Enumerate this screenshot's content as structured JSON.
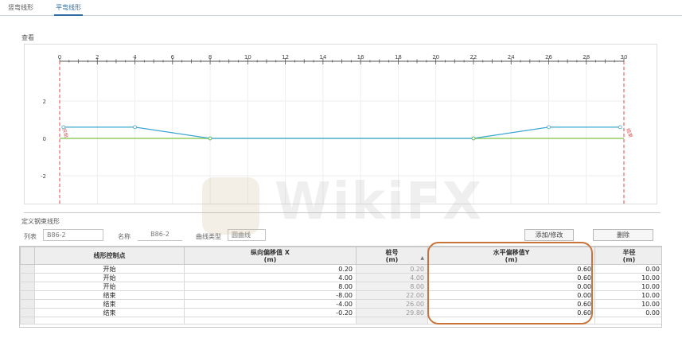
{
  "tabs": [
    {
      "label": "竖弯线形",
      "active": false
    },
    {
      "label": "平弯线形",
      "active": true
    }
  ],
  "view_label": "查看",
  "chart_data": {
    "type": "line",
    "x_ticks": [
      0,
      2,
      4,
      6,
      8,
      10,
      12,
      14,
      16,
      18,
      20,
      22,
      24,
      26,
      28,
      30
    ],
    "y_ticks": [
      2,
      0,
      -2
    ],
    "xlim": [
      0,
      30
    ],
    "ylim": [
      -3.2,
      4.2
    ],
    "series": [
      {
        "color": "#3ba5d4",
        "points": [
          [
            0.2,
            0.6
          ],
          [
            4,
            0.6
          ],
          [
            8,
            0
          ],
          [
            22,
            0
          ],
          [
            26,
            0.6
          ],
          [
            29.8,
            0.6
          ]
        ]
      },
      {
        "color": "#7cc242",
        "points": [
          [
            0,
            0
          ],
          [
            30,
            0
          ]
        ]
      }
    ],
    "annotations": [
      {
        "text": "开始",
        "x": 0,
        "color": "#e04b4b"
      },
      {
        "text": "结束",
        "x": 30,
        "color": "#e04b4b"
      }
    ]
  },
  "define_label": "定义钢束线形",
  "form": {
    "list_label": "列表",
    "list_value": "B86-2",
    "name_label": "名称",
    "name_value": "B86-2",
    "curve_label": "曲线类型",
    "curve_value": "圆曲线"
  },
  "buttons": {
    "add_modify": "添加/修改",
    "delete": "删除"
  },
  "table": {
    "headers": [
      {
        "line1": "线形控制点",
        "line2": ""
      },
      {
        "line1": "纵向偏移值 X",
        "line2": "(m)"
      },
      {
        "line1": "桩号",
        "line2": "(m)"
      },
      {
        "line1": "水平偏移值Y",
        "line2": "(m)"
      },
      {
        "line1": "半径",
        "line2": "(m)"
      }
    ],
    "sort_indicator": "▲",
    "rows": [
      {
        "point": "开始",
        "x": "0.20",
        "station": "0.20",
        "y": "0.60",
        "radius": "0.00"
      },
      {
        "point": "开始",
        "x": "4.00",
        "station": "4.00",
        "y": "0.60",
        "radius": "10.00"
      },
      {
        "point": "开始",
        "x": "8.00",
        "station": "8.00",
        "y": "0.00",
        "radius": "10.00"
      },
      {
        "point": "结束",
        "x": "-8.00",
        "station": "22.00",
        "y": "0.00",
        "radius": "10.00"
      },
      {
        "point": "结束",
        "x": "-4.00",
        "station": "26.00",
        "y": "0.60",
        "radius": "10.00"
      },
      {
        "point": "结束",
        "x": "-0.20",
        "station": "29.80",
        "y": "0.60",
        "radius": "0.00"
      }
    ]
  },
  "watermark": {
    "text": "WikiFX"
  },
  "colors": {
    "accent": "#2d6da3",
    "highlight": "#c8733a",
    "blue_line": "#3ba5d4",
    "green_line": "#7cc242",
    "marker": "#e04b4b"
  }
}
